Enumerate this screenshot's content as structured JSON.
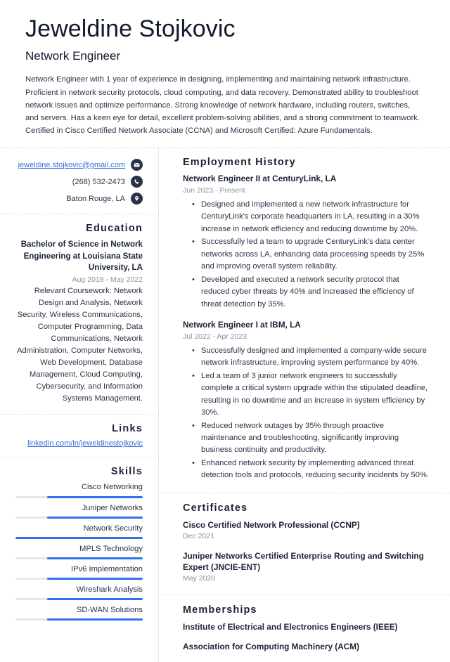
{
  "header": {
    "full_name": "Jeweldine Stojkovic",
    "job_title": "Network Engineer",
    "summary": "Network Engineer with 1 year of experience in designing, implementing and maintaining network infrastructure. Proficient in network security protocols, cloud computing, and data recovery. Demonstrated ability to troubleshoot network issues and optimize performance. Strong knowledge of network hardware, including routers, switches, and servers. Has a keen eye for detail, excellent problem-solving abilities, and a strong commitment to teamwork. Certified in Cisco Certified Network Associate (CCNA) and Microsoft Certified: Azure Fundamentals."
  },
  "contact": {
    "email": "jeweldine.stojkovic@gmail.com",
    "phone": "(268) 532-2473",
    "location": "Baton Rouge, LA",
    "email_icon": "envelope-icon",
    "phone_icon": "phone-icon",
    "location_icon": "map-pin-icon"
  },
  "education": {
    "title": "Education",
    "degree": "Bachelor of Science in Network Engineering at Louisiana State University, LA",
    "date": "Aug 2018 - May 2022",
    "description": "Relevant Coursework: Network Design and Analysis, Network Security, Wireless Communications, Computer Programming, Data Communications, Network Administration, Computer Networks, Web Development, Database Management, Cloud Computing, Cybersecurity, and Information Systems Management."
  },
  "links": {
    "title": "Links",
    "items": [
      {
        "label": "linkedin.com/in/jeweldinestojkovic"
      }
    ]
  },
  "skills": {
    "title": "Skills",
    "items": [
      {
        "name": "Cisco Networking",
        "level": 75
      },
      {
        "name": "Juniper Networks",
        "level": 75
      },
      {
        "name": "Network Security",
        "level": 100
      },
      {
        "name": "MPLS Technology",
        "level": 75
      },
      {
        "name": "IPv6 Implementation",
        "level": 75
      },
      {
        "name": "Wireshark Analysis",
        "level": 75
      },
      {
        "name": "SD-WAN Solutions",
        "level": 75
      }
    ]
  },
  "employment": {
    "title": "Employment History",
    "jobs": [
      {
        "heading": "Network Engineer II at CenturyLink, LA",
        "date": "Jun 2023 - Present",
        "bullets": [
          "Designed and implemented a new network infrastructure for CenturyLink's corporate headquarters in LA, resulting in a 30% increase in network efficiency and reducing downtime by 20%.",
          "Successfully led a team to upgrade CenturyLink's data center networks across LA, enhancing data processing speeds by 25% and improving overall system reliability.",
          "Developed and executed a network security protocol that reduced cyber threats by 40% and increased the efficiency of threat detection by 35%."
        ]
      },
      {
        "heading": "Network Engineer I at IBM, LA",
        "date": "Jul 2022 - Apr 2023",
        "bullets": [
          "Successfully designed and implemented a company-wide secure network infrastructure, improving system performance by 40%.",
          "Led a team of 3 junior network engineers to successfully complete a critical system upgrade within the stipulated deadline, resulting in no downtime and an increase in system efficiency by 30%.",
          "Reduced network outages by 35% through proactive maintenance and troubleshooting, significantly improving business continuity and productivity.",
          "Enhanced network security by implementing advanced threat detection tools and protocols, reducing security incidents by 50%."
        ]
      }
    ]
  },
  "certificates": {
    "title": "Certificates",
    "items": [
      {
        "name": "Cisco Certified Network Professional (CCNP)",
        "date": "Dec 2021"
      },
      {
        "name": "Juniper Networks Certified Enterprise Routing and Switching Expert (JNCIE-ENT)",
        "date": "May 2020"
      }
    ]
  },
  "memberships": {
    "title": "Memberships",
    "items": [
      {
        "name": "Institute of Electrical and Electronics Engineers (IEEE)"
      },
      {
        "name": "Association for Computing Machinery (ACM)"
      }
    ]
  },
  "colors": {
    "accent_blue": "#2f71ef",
    "link_blue": "#3b6fd4",
    "heading_navy": "#1b2336",
    "muted_gray": "#8b919e"
  }
}
